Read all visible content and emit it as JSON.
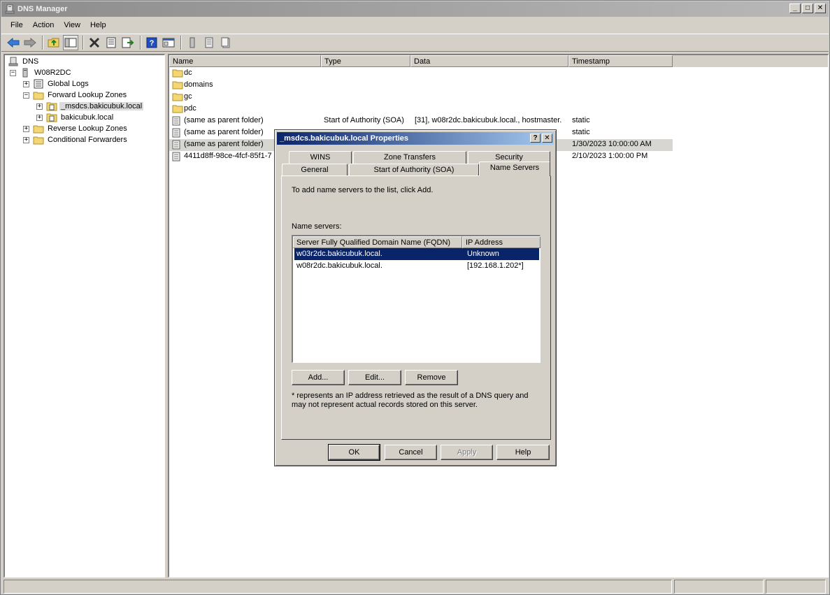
{
  "window": {
    "title": "DNS Manager",
    "controls": {
      "minimize": "_",
      "maximize": "□",
      "close": "✕"
    }
  },
  "menu": {
    "items": [
      "File",
      "Action",
      "View",
      "Help"
    ]
  },
  "toolbar": {
    "icons": [
      "back-icon",
      "forward-icon",
      "up-folder-icon",
      "show-hide-tree-icon",
      "delete-icon",
      "properties-icon",
      "export-icon",
      "help-icon",
      "mmc-icon",
      "server-icon",
      "record-icon",
      "records-icon"
    ]
  },
  "tree": {
    "root": "DNS",
    "server": "W08R2DC",
    "global_logs": "Global Logs",
    "forward_zones": "Forward Lookup Zones",
    "zone_msdcs": "_msdcs.bakicubuk.local",
    "zone_local": "bakicubuk.local",
    "reverse_zones": "Reverse Lookup Zones",
    "conditional_forwarders": "Conditional Forwarders"
  },
  "list": {
    "columns": [
      "Name",
      "Type",
      "Data",
      "Timestamp"
    ],
    "rows": [
      {
        "name": "dc",
        "type": "",
        "data": "",
        "timestamp": "",
        "icon": "folder-icon"
      },
      {
        "name": "domains",
        "type": "",
        "data": "",
        "timestamp": "",
        "icon": "folder-icon"
      },
      {
        "name": "gc",
        "type": "",
        "data": "",
        "timestamp": "",
        "icon": "folder-icon"
      },
      {
        "name": "pdc",
        "type": "",
        "data": "",
        "timestamp": "",
        "icon": "folder-icon"
      },
      {
        "name": "(same as parent folder)",
        "type": "Start of Authority (SOA)",
        "data": "[31], w08r2dc.bakicubuk.local., hostmaster.",
        "timestamp": "static",
        "icon": "record-icon"
      },
      {
        "name": "(same as parent folder)",
        "type": "",
        "data": "",
        "timestamp": "static",
        "icon": "record-icon"
      },
      {
        "name": "(same as parent folder)",
        "type": "",
        "data": "",
        "timestamp": "1/30/2023 10:00:00 AM",
        "icon": "record-icon",
        "selected": true
      },
      {
        "name": "4411d8ff-98ce-4fcf-85f1-7",
        "type": "",
        "data": "",
        "timestamp": "2/10/2023 1:00:00 PM",
        "icon": "record-icon"
      }
    ]
  },
  "dialog": {
    "title": "_msdcs.bakicubuk.local Properties",
    "help_btn": "?",
    "close_btn": "✕",
    "tabs_back": [
      "WINS",
      "Zone Transfers",
      "Security"
    ],
    "tabs_front": [
      "General",
      "Start of Authority (SOA)",
      "Name Servers"
    ],
    "active_tab": "Name Servers",
    "instruction": "To add name servers to the list, click Add.",
    "name_servers_label": "Name servers:",
    "columns": [
      "Server Fully Qualified Domain Name (FQDN)",
      "IP Address"
    ],
    "servers": [
      {
        "fqdn": "w03r2dc.bakicubuk.local.",
        "ip": "Unknown",
        "selected": true
      },
      {
        "fqdn": "w08r2dc.bakicubuk.local.",
        "ip": "[192.168.1.202*]",
        "selected": false
      }
    ],
    "add_btn": "Add...",
    "edit_btn": "Edit...",
    "remove_btn": "Remove",
    "footnote": "* represents an IP address retrieved as the result of a DNS query and may not represent actual records stored on this server.",
    "ok_btn": "OK",
    "cancel_btn": "Cancel",
    "apply_btn": "Apply",
    "help_button": "Help"
  },
  "colors": {
    "title_inactive": "#8c8c8c",
    "dialog_title": "#0a246a",
    "selection": "#0a246a",
    "face": "#d4d0c8"
  }
}
